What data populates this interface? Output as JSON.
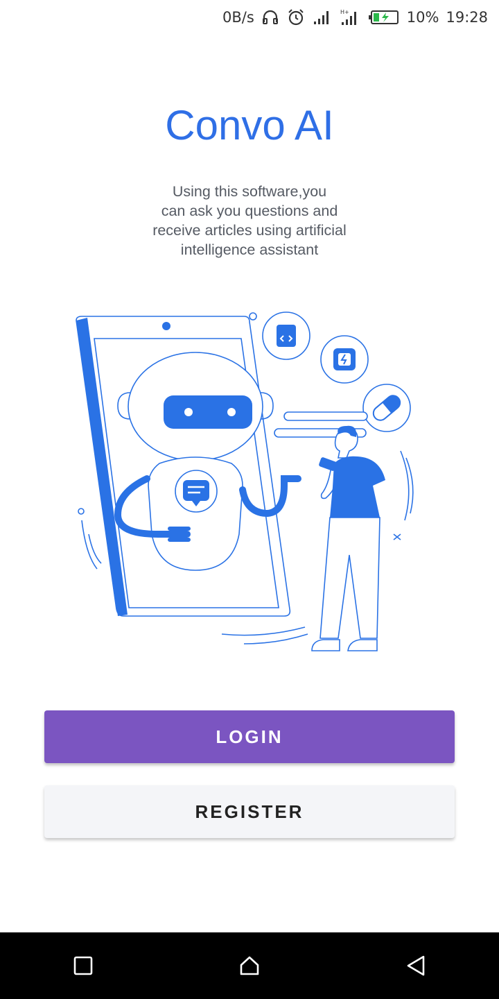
{
  "status_bar": {
    "net_speed": "0B/s",
    "battery_percent": "10%",
    "time": "19:28",
    "icons": [
      "headphones-icon",
      "alarm-icon",
      "signal-icon",
      "signal-hd-icon",
      "battery-charging-icon"
    ],
    "battery_level": 0.1
  },
  "app": {
    "title": "Convo AI",
    "subtitle_lines": [
      "Using this software,you",
      "can ask you questions and",
      "receive articles using artificial",
      "intelligence assistant"
    ]
  },
  "buttons": {
    "login_label": "LOGIN",
    "register_label": "REGISTER"
  },
  "colors": {
    "title": "#2f6fe6",
    "illustration_blue": "#2a72e5",
    "login_button": "#7b55c1",
    "register_button": "#f4f5f8",
    "nav_bar": "#000000"
  },
  "nav": {
    "icons": [
      "recent-apps-icon",
      "home-icon",
      "back-icon"
    ]
  }
}
